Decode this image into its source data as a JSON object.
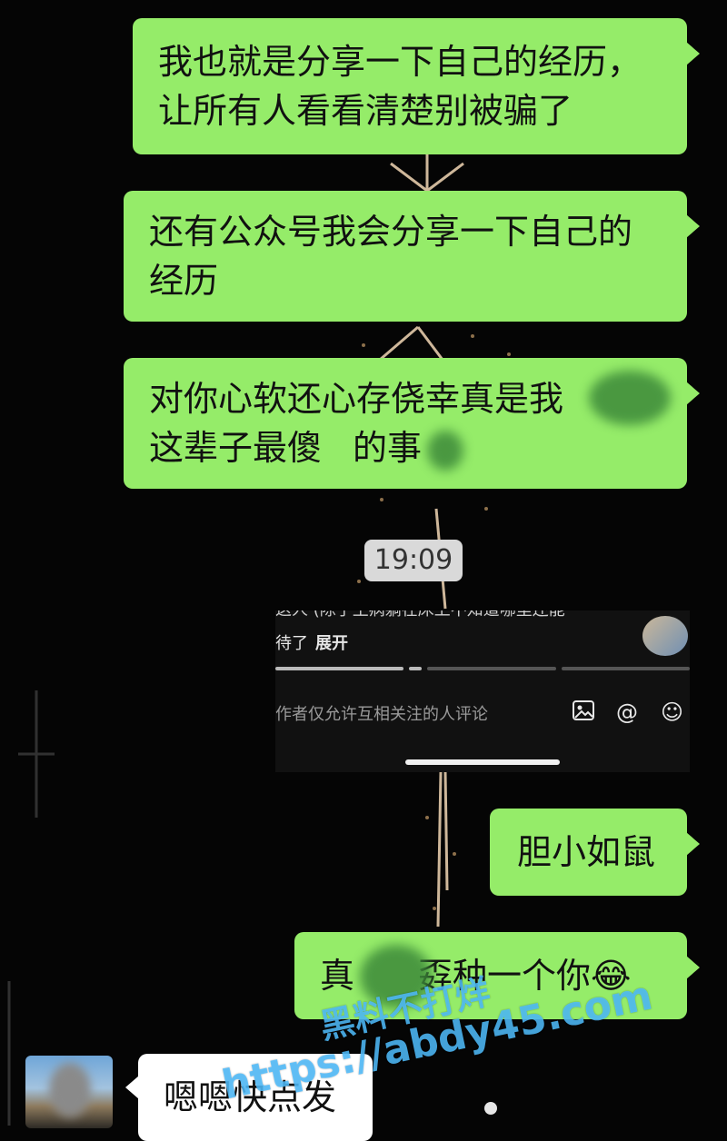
{
  "messages": [
    {
      "side": "right",
      "lines": [
        "我也就是分享一下自己的经历，",
        "让所有人看看清楚别被骗了"
      ]
    },
    {
      "side": "right",
      "lines": [
        "还有公众号我会分享一下自己的",
        "经历"
      ]
    },
    {
      "side": "right",
      "lines": [
        "对你心软还心存侥幸真是我",
        "这辈子最傻",
        "的事"
      ]
    },
    {
      "side": "right",
      "lines": [
        "胆小如鼠"
      ]
    },
    {
      "side": "right",
      "lines": [
        "真",
        "孬种一个你",
        "😂"
      ]
    },
    {
      "side": "left",
      "lines": [
        "嗯嗯快点发"
      ]
    }
  ],
  "timestamp": "19:09",
  "embedded_post": {
    "truncated_line": "这人 (除了生病躺在床上不知道哪里还能",
    "more_text": "待了",
    "expand_label": "展开",
    "comment_placeholder": "作者仅允许互相关注的人评论",
    "icons": [
      "image-icon",
      "at-icon",
      "emoji-icon"
    ],
    "progress_segments": 4,
    "progress_active_segment": 2
  },
  "watermark": {
    "line1": "黑料不打烊",
    "line2": "https://abdy45.com"
  },
  "colors": {
    "sent_bubble": "#95EC69",
    "received_bubble": "#ffffff",
    "background": "#050505",
    "watermark": "#50BEFF"
  }
}
